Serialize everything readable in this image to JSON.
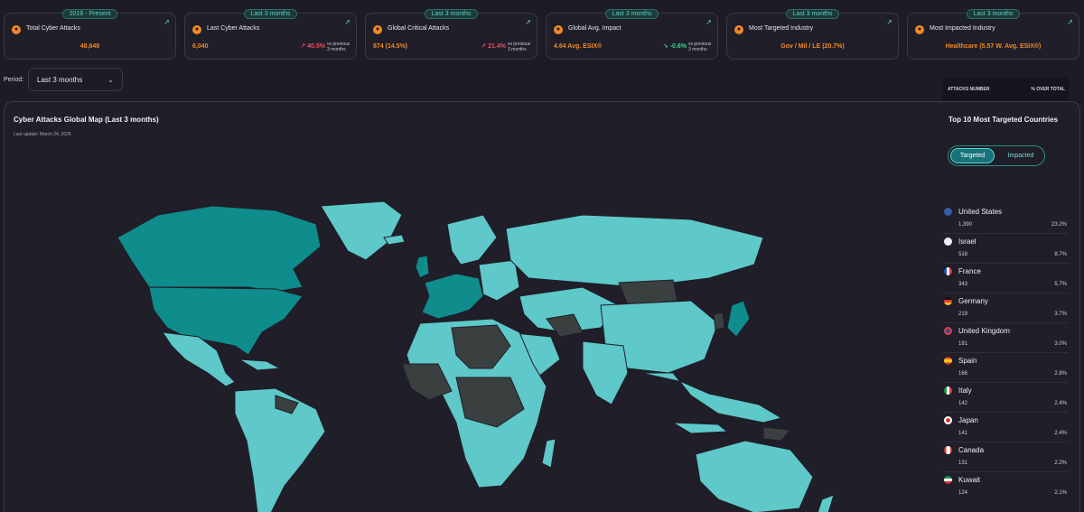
{
  "cards": [
    {
      "pill": "2018 - Present",
      "title": "Total Cyber Attacks",
      "value": "48,649"
    },
    {
      "pill": "Last 3 months",
      "title": "Last Cyber Attacks",
      "value": "6,040",
      "delta": "40.5%",
      "delta_dir": "up",
      "vs": "vs previous 3 months"
    },
    {
      "pill": "Last 3 months",
      "title": "Global Critical Attacks",
      "value": "874 (14.5%)",
      "delta": "21.4%",
      "delta_dir": "up",
      "vs": "vs previous 3 months"
    },
    {
      "pill": "Last 3 months",
      "title": "Global Avg. Impact",
      "value": "4.64 Avg. ESIX®",
      "delta": "-0.6%",
      "delta_dir": "down",
      "vs": "vs previous 3 months"
    },
    {
      "pill": "Last 3 months",
      "title": "Most Targeted Industry",
      "value": "Gov / Mil / LE (20.7%)"
    },
    {
      "pill": "Last 3 months",
      "title": "Most Impacted Industry",
      "value": "Healthcare (5.57 W. Avg. ESIX®)"
    }
  ],
  "period": {
    "label": "Period:",
    "value": "Last 3 months"
  },
  "map": {
    "title": "Cyber Attacks Global Map (Last 3 months)",
    "updated": "Last update: March 24, 2026"
  },
  "side": {
    "title": "Top 10 Most Targeted Countries",
    "toggle": {
      "on": "Targeted",
      "off": "Impacted"
    },
    "col1": "ATTACKS NUMBER",
    "col2": "% OVER TOTAL",
    "rows": [
      {
        "country": "United States",
        "attacks": "1,390",
        "pct": "23.2%"
      },
      {
        "country": "Israel",
        "attacks": "518",
        "pct": "8.7%"
      },
      {
        "country": "France",
        "attacks": "343",
        "pct": "5.7%"
      },
      {
        "country": "Germany",
        "attacks": "219",
        "pct": "3.7%"
      },
      {
        "country": "United Kingdom",
        "attacks": "181",
        "pct": "3.0%"
      },
      {
        "country": "Spain",
        "attacks": "166",
        "pct": "2.8%"
      },
      {
        "country": "Italy",
        "attacks": "142",
        "pct": "2.4%"
      },
      {
        "country": "Japan",
        "attacks": "141",
        "pct": "2.4%"
      },
      {
        "country": "Canada",
        "attacks": "131",
        "pct": "2.2%"
      },
      {
        "country": "Kuwait",
        "attacks": "124",
        "pct": "2.1%"
      }
    ]
  },
  "colors": {
    "accent": "#5fd3c9",
    "high": "#0f8c8c",
    "low": "#3a3f40",
    "orange": "#f08a24"
  }
}
